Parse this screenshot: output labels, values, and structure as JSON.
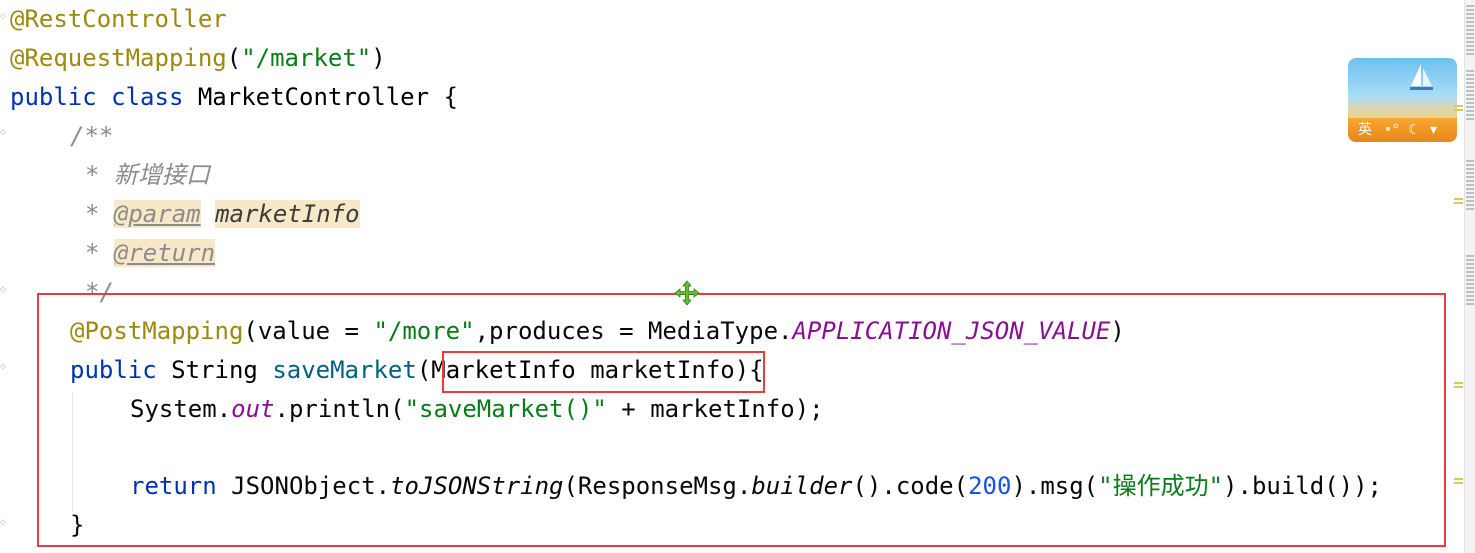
{
  "code": {
    "line1": {
      "annotation": "@RestController"
    },
    "line2": {
      "annotation": "@RequestMapping",
      "open": "(",
      "path": "\"/market\"",
      "close": ")"
    },
    "line3": {
      "kw_public": "public",
      "kw_class": "class",
      "class_name": "MarketController",
      "brace": "{"
    },
    "line4": {
      "comment_open": "/**"
    },
    "line5": {
      "star": "* ",
      "desc": "新增接口"
    },
    "line6": {
      "star": "* ",
      "tag": "@param",
      "param": "marketInfo"
    },
    "line7": {
      "star": "* ",
      "tag": "@return"
    },
    "line8": {
      "comment_close": "*/"
    },
    "line9": {
      "annotation": "@PostMapping",
      "args_start": "(value = ",
      "value": "\"/more\"",
      "args_mid": ",produces = MediaType.",
      "constant": "APPLICATION_JSON_VALUE",
      "args_end": ")"
    },
    "line10": {
      "kw_public": "public",
      "return_type": "String",
      "method": "saveMarket",
      "paren_open": "(",
      "param_type": "MarketInfo",
      "param_name": "marketInfo",
      "paren_close": ")",
      "brace": "{"
    },
    "line11": {
      "prefix": "System.",
      "field": "out",
      "call": ".println(",
      "str": "\"saveMarket()\"",
      "suffix": " + marketInfo);"
    },
    "line13": {
      "kw_return": "return",
      "cls": " JSONObject.",
      "static_method": "toJSONString",
      "mid1": "(ResponseMsg.",
      "builder": "builder",
      "mid2": "().code(",
      "code": "200",
      "mid3": ").msg(",
      "msg": "\"操作成功\"",
      "end": ").build());"
    },
    "line14": {
      "brace": "}"
    }
  },
  "ime": {
    "lang_label": "英",
    "icons": [
      "moon-icon",
      "shirt-icon"
    ]
  },
  "colors": {
    "keyword": "#0033b3",
    "annotation": "#9e880d",
    "string": "#067d17",
    "method": "#00627a",
    "constant": "#871094",
    "number": "#1750eb",
    "comment": "#8c8c8c",
    "highlight_box": "#e63e3e"
  }
}
